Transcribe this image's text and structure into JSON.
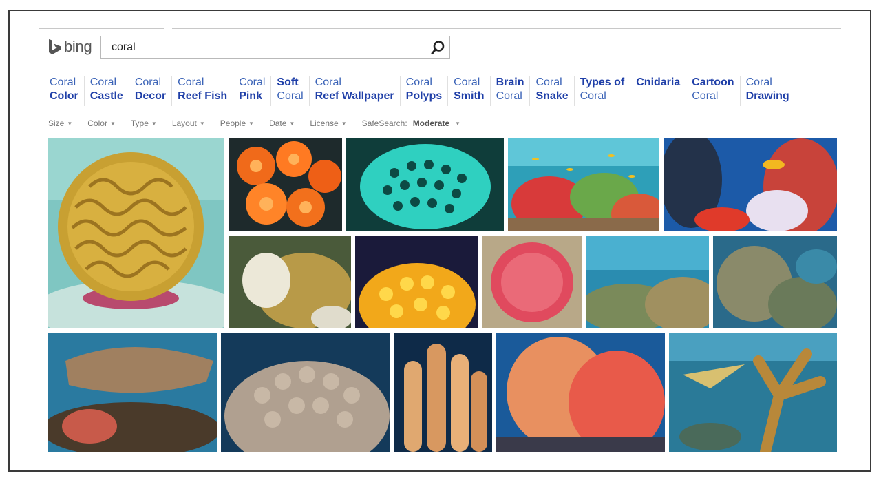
{
  "header": {
    "logo_text": "bing",
    "search": {
      "value": "coral",
      "placeholder": ""
    },
    "search_button_icon": "search-icon"
  },
  "related_searches": [
    {
      "l1": "Coral",
      "l2": "Color",
      "bold": 2
    },
    {
      "l1": "Coral",
      "l2": "Castle",
      "bold": 2
    },
    {
      "l1": "Coral",
      "l2": "Decor",
      "bold": 2
    },
    {
      "l1": "Coral",
      "l2": "Reef Fish",
      "bold": 2
    },
    {
      "l1": "Coral",
      "l2": "Pink",
      "bold": 2
    },
    {
      "l1": "Soft",
      "l2": "Coral",
      "bold": 1
    },
    {
      "l1": "Coral",
      "l2": "Reef Wallpaper",
      "bold": 2
    },
    {
      "l1": "Coral",
      "l2": "Polyps",
      "bold": 2
    },
    {
      "l1": "Coral",
      "l2": "Smith",
      "bold": 2
    },
    {
      "l1": "Brain",
      "l2": "Coral",
      "bold": 1
    },
    {
      "l1": "Coral",
      "l2": "Snake",
      "bold": 2
    },
    {
      "l1": "Types of",
      "l2": "Coral",
      "bold": 1
    },
    {
      "l1": "Cnidaria",
      "l2": "",
      "bold": 1
    },
    {
      "l1": "Cartoon",
      "l2": "Coral",
      "bold": 1
    },
    {
      "l1": "Coral",
      "l2": "Drawing",
      "bold": 2
    }
  ],
  "filters": [
    "Size",
    "Color",
    "Type",
    "Layout",
    "People",
    "Date",
    "License"
  ],
  "safesearch": {
    "label": "SafeSearch:",
    "value": "Moderate"
  },
  "colors": {
    "link": "#3b63b7",
    "link_bold": "#1f3fa8",
    "logo": "#555555"
  },
  "images": [
    {
      "name": "brain-coral"
    },
    {
      "name": "orange-sun-coral"
    },
    {
      "name": "teal-honeycomb-coral"
    },
    {
      "name": "reef-with-fish"
    },
    {
      "name": "blue-reef-scene"
    },
    {
      "name": "white-yellow-coral"
    },
    {
      "name": "yellow-polyps"
    },
    {
      "name": "pink-coral"
    },
    {
      "name": "reef-wide-view"
    },
    {
      "name": "reef-boulders"
    },
    {
      "name": "table-coral"
    },
    {
      "name": "beige-finger-coral"
    },
    {
      "name": "pillar-coral"
    },
    {
      "name": "sea-fans"
    },
    {
      "name": "elkhorn-coral"
    }
  ]
}
